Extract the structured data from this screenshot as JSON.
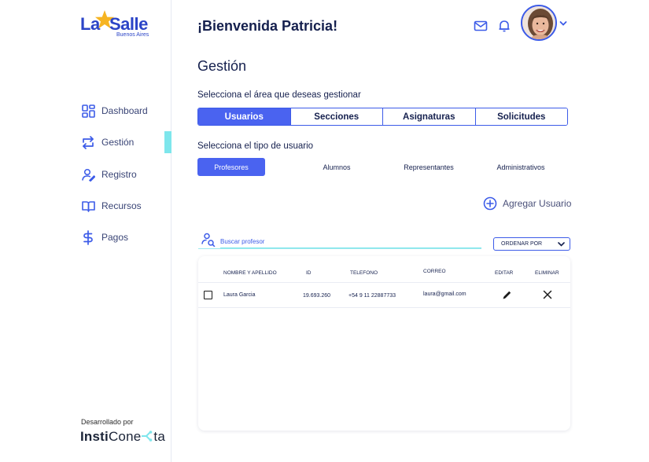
{
  "brand": {
    "name_part1": "La",
    "name_part2": "Salle",
    "subtitle": "Buenos Aires"
  },
  "sidebar": {
    "items": [
      {
        "label": "Dashboard",
        "icon": "dashboard-grid-icon"
      },
      {
        "label": "Gestión",
        "icon": "repeat-icon"
      },
      {
        "label": "Registro",
        "icon": "user-edit-icon"
      },
      {
        "label": "Recursos",
        "icon": "book-icon"
      },
      {
        "label": "Pagos",
        "icon": "dollar-icon"
      }
    ],
    "active": "Gestión",
    "developed_by": "Desarrollado por",
    "dev_brand_a": "Insti",
    "dev_brand_b": "Cone",
    "dev_brand_c": "ta"
  },
  "header": {
    "welcome": "¡Bienvenida Patricia!"
  },
  "main": {
    "title": "Gestión",
    "area_prompt": "Selecciona el área que deseas gestionar",
    "area_tabs": [
      "Usuarios",
      "Secciones",
      "Asignaturas",
      "Solicitudes"
    ],
    "area_active": "Usuarios",
    "type_prompt": "Selecciona el tipo de usuario",
    "type_tabs": [
      "Profesores",
      "Alumnos",
      "Representantes",
      "Administrativos"
    ],
    "type_active": "Profesores",
    "add_user": "Agregar Usuario",
    "search": {
      "placeholder": "Buscar profesor"
    },
    "order_by": "ORDENAR POR",
    "table": {
      "columns": [
        "NOMBRE Y APELLIDO",
        "ID",
        "TELEFONO",
        "CORREO",
        "EDITAR",
        "ELIMINAR"
      ],
      "rows": [
        {
          "name": "Laura Garcia",
          "id": "19.693.260",
          "phone": "+54 9 11 22887733",
          "email": "laura@gmail.com"
        }
      ]
    }
  },
  "colors": {
    "accent": "#4a63f0",
    "brand_blue": "#2b44c7",
    "star": "#f6b422",
    "highlight": "#7ee6ec",
    "text": "#15204e"
  }
}
